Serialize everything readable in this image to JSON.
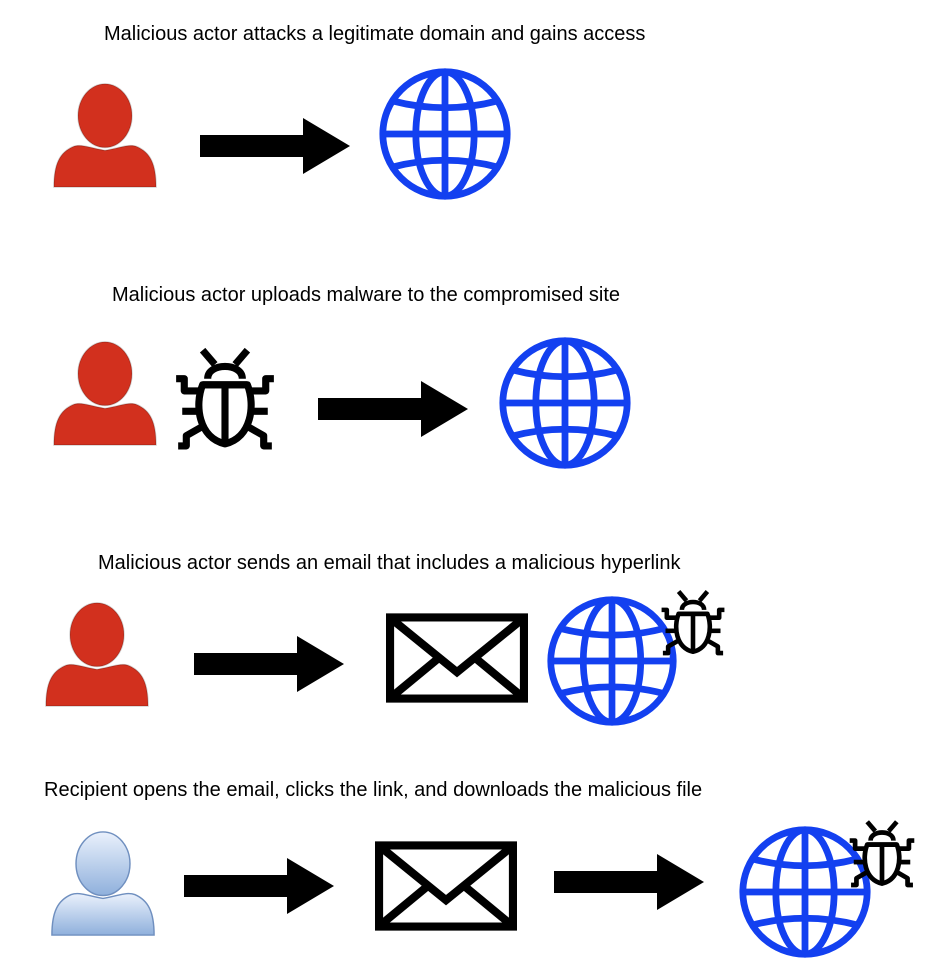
{
  "steps": [
    {
      "caption": "Malicious actor attacks a legitimate domain and gains access",
      "actor": "attacker",
      "icons": [
        "person-icon",
        "arrow-right-icon",
        "globe-icon"
      ]
    },
    {
      "caption": "Malicious actor uploads malware to the compromised site",
      "actor": "attacker",
      "icons": [
        "person-icon",
        "bug-icon",
        "arrow-right-icon",
        "globe-icon"
      ]
    },
    {
      "caption": "Malicious actor sends an email that includes a malicious hyperlink",
      "actor": "attacker",
      "icons": [
        "person-icon",
        "arrow-right-icon",
        "envelope-icon",
        "globe-icon",
        "bug-icon"
      ]
    },
    {
      "caption": "Recipient opens the email, clicks the link, and downloads the malicious file",
      "actor": "recipient",
      "icons": [
        "person-icon",
        "arrow-right-icon",
        "envelope-icon",
        "arrow-right-icon",
        "globe-icon",
        "bug-icon"
      ]
    }
  ],
  "colors": {
    "attacker": "#d2301e",
    "recipient_light": "#dfe9f9",
    "recipient_dark": "#8fb0dc",
    "recipient_stroke": "#6f8fbf",
    "globe": "#1340f0",
    "arrow": "#000000",
    "bug": "#000000",
    "envelope": "#000000"
  }
}
